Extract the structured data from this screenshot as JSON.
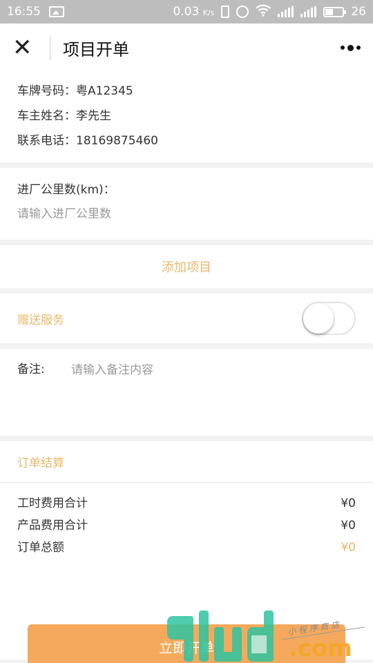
{
  "status_bar": {
    "time": "16:55",
    "net_speed": "0.03",
    "net_unit": "K/s",
    "battery": "26"
  },
  "nav": {
    "title": "项目开单"
  },
  "vehicle": {
    "plate": "车牌号码：粤A12345",
    "owner": "车主姓名：李先生",
    "phone": "联系电话：18169875460"
  },
  "mileage": {
    "label": "进厂公里数(km)：",
    "placeholder": "请输入进厂公里数"
  },
  "add_item": "添加项目",
  "gift_service": {
    "label": "赠送服务",
    "enabled": false
  },
  "remark": {
    "label": "备注:",
    "placeholder": "请输入备注内容"
  },
  "settlement": {
    "title": "订单结算",
    "rows": [
      {
        "label": "工时费用合计",
        "value": "¥0"
      },
      {
        "label": "产品费用合计",
        "value": "¥0"
      },
      {
        "label": "订单总额",
        "value": "¥0"
      }
    ]
  },
  "submit_label": "立即开单",
  "watermark": {
    "brand": "9lud.com",
    "tagline": "小 程 序 商 店"
  },
  "colors": {
    "accent": "#e8b96a",
    "button": "#f5a95c",
    "status_bar": "#bdbdbd"
  }
}
